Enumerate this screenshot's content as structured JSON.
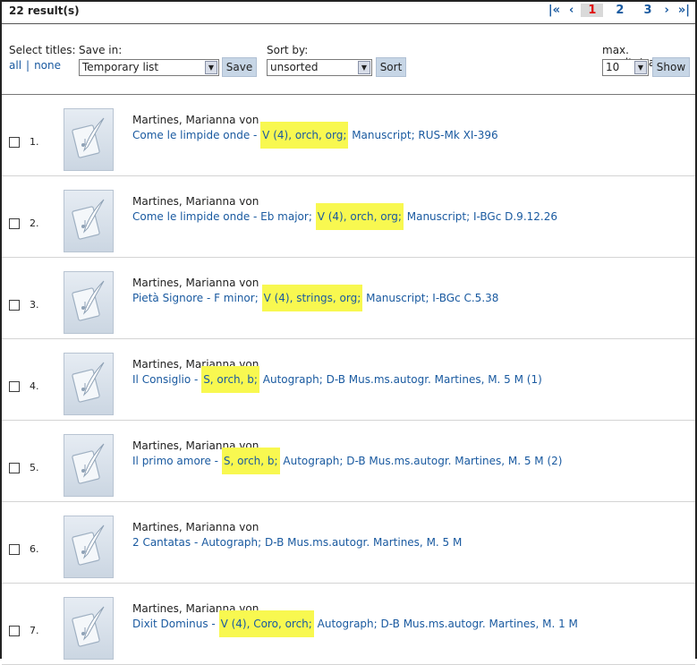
{
  "header": {
    "result_count": "22 result(s)",
    "pager": {
      "first": "|«",
      "prev": "‹",
      "pages": [
        "1",
        "2",
        "3"
      ],
      "current": "1",
      "next": "›",
      "last": "»|"
    }
  },
  "controls": {
    "select_titles_label": "Select titles:",
    "select_all": "all",
    "select_sep": "|",
    "select_none": "none",
    "save_in_label": "Save in:",
    "save_in_value": "Temporary list",
    "save_button": "Save",
    "sort_by_label": "Sort by:",
    "sort_by_value": "unsorted",
    "sort_button": "Sort",
    "max_results_label": "max. results/page",
    "max_results_value": "10",
    "show_button": "Show"
  },
  "results": [
    {
      "num": "1.",
      "author": "Martines, Marianna von",
      "before": "Come le limpide onde - ",
      "highlight": "V (4), orch, org;",
      "after": " Manuscript; RUS-Mk XI-396"
    },
    {
      "num": "2.",
      "author": "Martines, Marianna von",
      "before": "Come le limpide onde - Eb major; ",
      "highlight": "V (4), orch, org;",
      "after": " Manuscript; I-BGc D.9.12.26"
    },
    {
      "num": "3.",
      "author": "Martines, Marianna von",
      "before": "Pietà Signore - F minor; ",
      "highlight": "V (4), strings, org;",
      "after": " Manuscript; I-BGc C.5.38"
    },
    {
      "num": "4.",
      "author": "Martines, Marianna von",
      "before": "Il Consiglio - ",
      "highlight": "S, orch, b;",
      "after": " Autograph; D-B Mus.ms.autogr. Martines, M. 5 M (1)"
    },
    {
      "num": "5.",
      "author": "Martines, Marianna von",
      "before": "Il primo amore - ",
      "highlight": "S, orch, b;",
      "after": " Autograph; D-B Mus.ms.autogr. Martines, M. 5 M (2)"
    },
    {
      "num": "6.",
      "author": "Martines, Marianna von",
      "before": "2 Cantatas - Autograph; D-B Mus.ms.autogr. Martines, M. 5 M",
      "highlight": "",
      "after": ""
    },
    {
      "num": "7.",
      "author": "Martines, Marianna von",
      "before": "Dixit Dominus - ",
      "highlight": "V (4), Coro, orch;",
      "after": " Autograph; D-B Mus.ms.autogr. Martines, M. 1 M"
    }
  ],
  "icons": {
    "thumbnail": "manuscript-quill-icon",
    "select_arrow": "chevron-down-icon"
  },
  "colors": {
    "link": "#1a5aa0",
    "highlight": "#f8f850",
    "current_page": "#e01010",
    "button": "#c7d6e6"
  }
}
